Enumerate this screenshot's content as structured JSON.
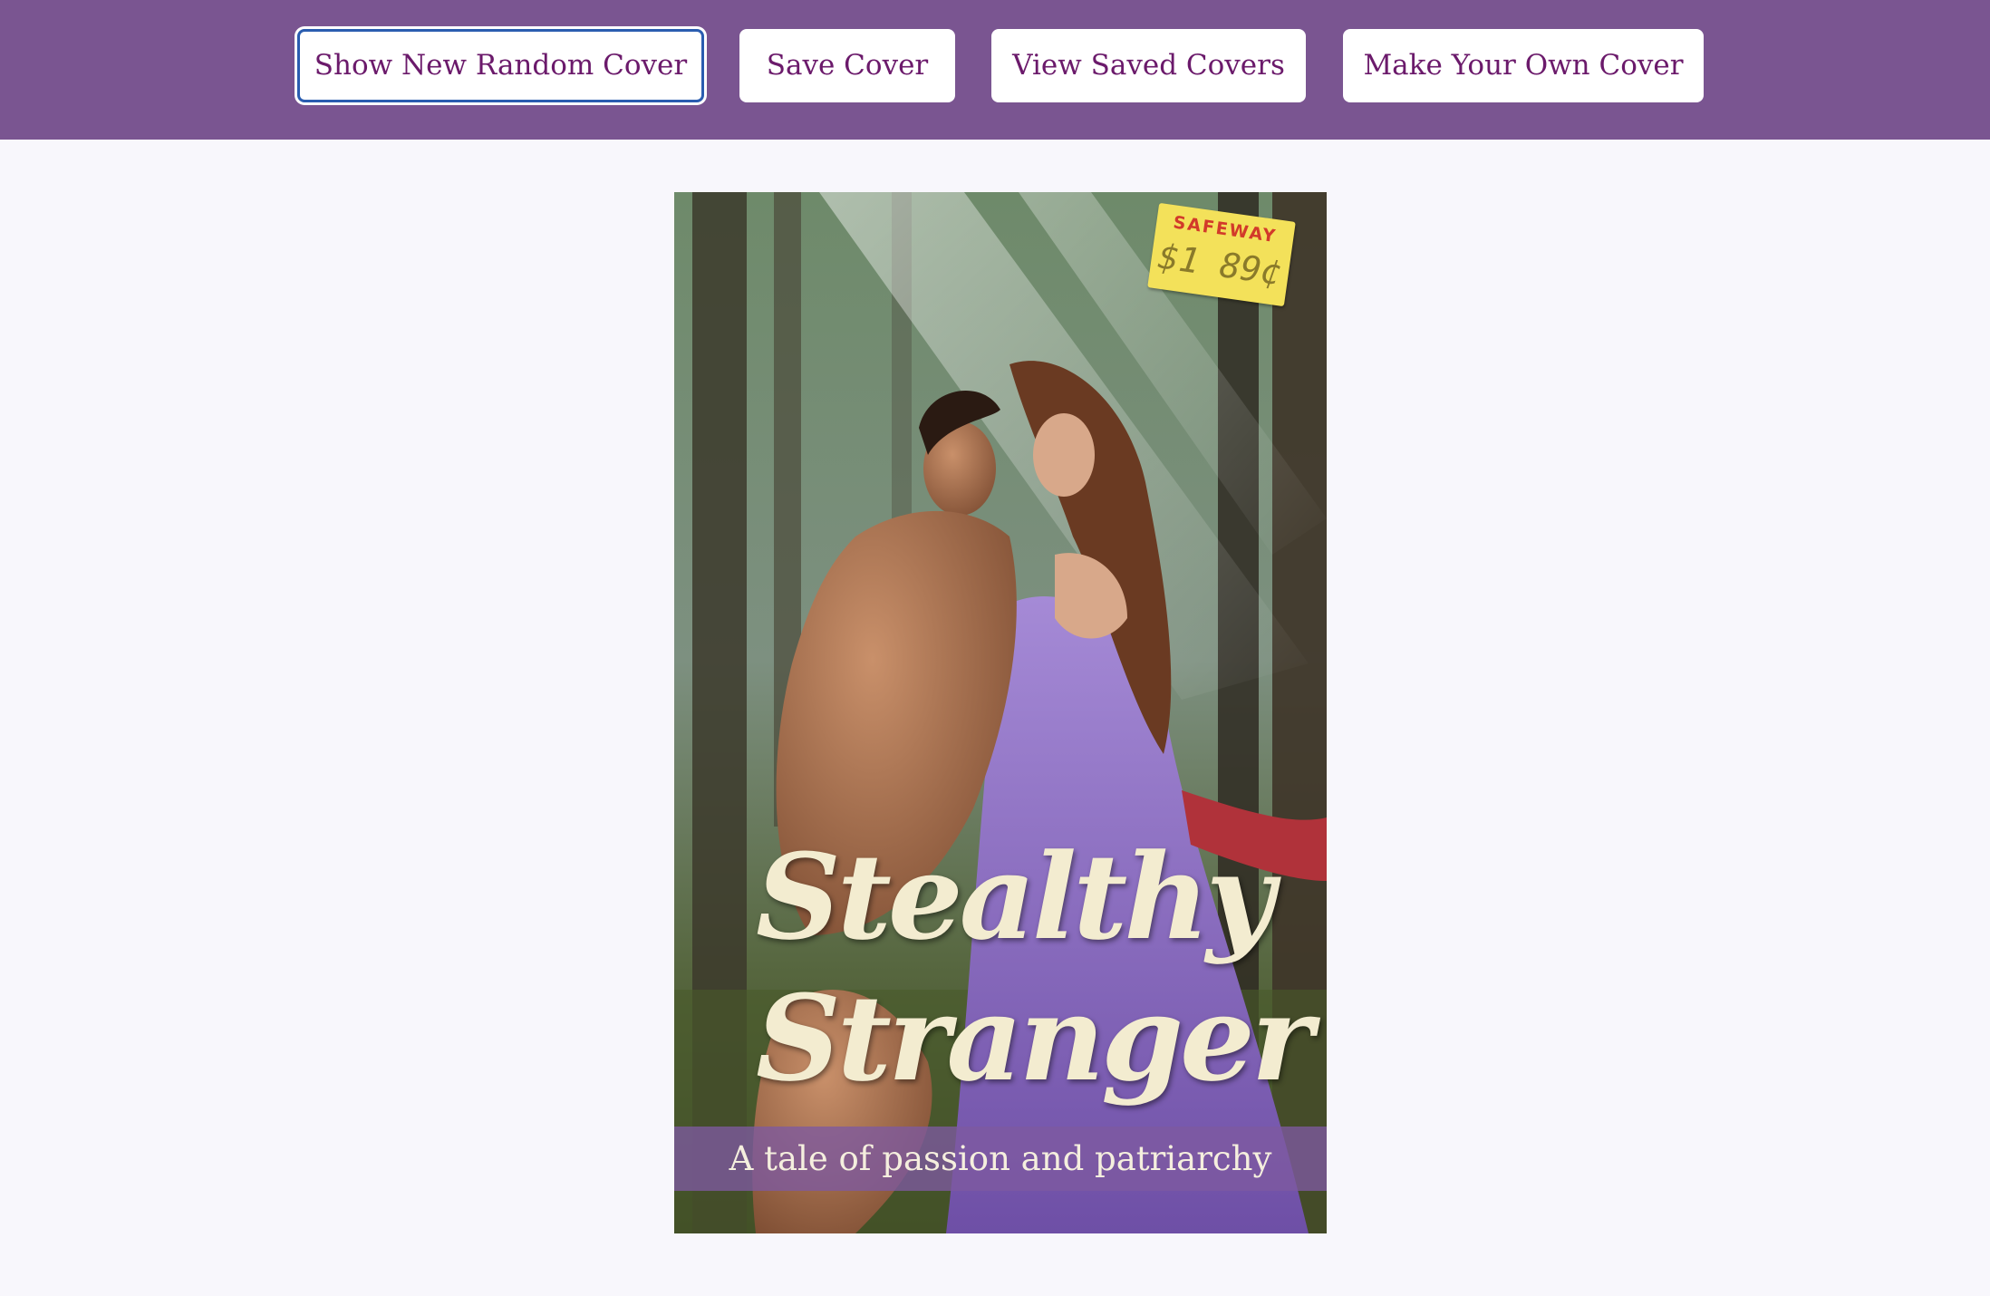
{
  "toolbar": {
    "random_label": "Show New Random Cover",
    "save_label": "Save Cover",
    "view_saved_label": "View Saved Covers",
    "make_own_label": "Make Your Own Cover"
  },
  "cover": {
    "title": "Stealthy\nStranger",
    "tagline": "A tale of passion and patriarchy",
    "price_tag": {
      "store": "SAFEWAY",
      "price": "$1 89¢"
    }
  },
  "colors": {
    "header_bg": "#7a5591",
    "button_text": "#6b1a6b",
    "page_bg": "#f8f7fc",
    "title_text": "#f3ecd0",
    "focus_outline": "#2a5db0"
  }
}
